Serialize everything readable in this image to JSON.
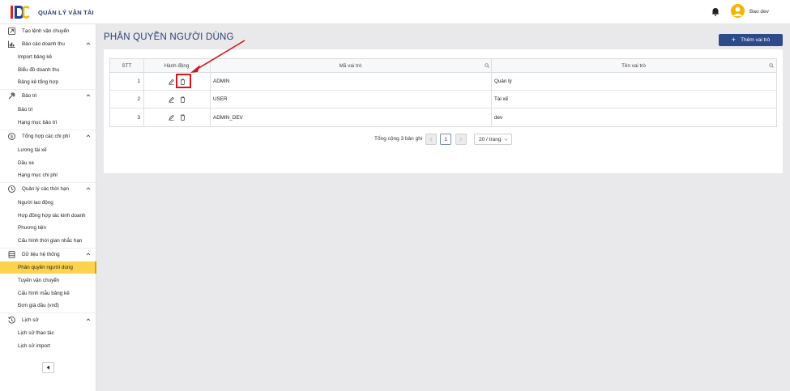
{
  "header": {
    "logo_text": "IDC",
    "app_title": "QUẢN LÝ VẬN TẢI",
    "user_name": "Bao dev"
  },
  "sidebar": {
    "top_item": "Tạo lệnh vận chuyển",
    "groups": [
      {
        "label": "Báo cáo doanh thu",
        "icon": "chart-icon",
        "items": [
          "Import bảng kê",
          "Biểu đồ doanh thu",
          "Bảng kê tổng hợp"
        ]
      },
      {
        "label": "Bảo trì",
        "icon": "wrench-icon",
        "items": [
          "Bảo trì",
          "Hạng mục bảo trì"
        ]
      },
      {
        "label": "Tổng hợp các chi phí",
        "icon": "dollar-icon",
        "items": [
          "Lương tài xế",
          "Dầu xe",
          "Hạng mục chi phí"
        ]
      },
      {
        "label": "Quản lý các thời hạn",
        "icon": "clock-icon",
        "items": [
          "Người lao động",
          "Hợp đồng hợp tác kinh doanh",
          "Phương tiện",
          "Cấu hình thời gian nhắc hạn"
        ]
      },
      {
        "label": "Dữ liệu hệ thống",
        "icon": "database-icon",
        "items": [
          "Phân quyền người dùng",
          "Tuyến vận chuyển",
          "Cấu hình mẫu bảng kê",
          "Đơn giá dầu (vnđ)"
        ]
      },
      {
        "label": "Lịch sử",
        "icon": "history-icon",
        "items": [
          "Lịch sử thao tác",
          "Lịch sử import"
        ]
      }
    ],
    "active_item": "Phân quyền người dùng"
  },
  "main": {
    "page_title": "PHÂN QUYỀN NGƯỜI DÙNG",
    "add_button": "Thêm vai trò",
    "table": {
      "columns": [
        "STT",
        "Hành động",
        "Mã vai trò",
        "Tên vai trò"
      ],
      "rows": [
        {
          "stt": "1",
          "code": "ADMIN",
          "name": "Quản lý"
        },
        {
          "stt": "2",
          "code": "USER",
          "name": "Tài xế"
        },
        {
          "stt": "3",
          "code": "ADMIN_DEV",
          "name": "dev"
        }
      ]
    },
    "pagination": {
      "total_text": "Tổng cộng 3 bản ghi",
      "current_page": "1",
      "page_size": "20 / trang"
    }
  },
  "colors": {
    "brand": "#2b3f73",
    "button": "#2d4a8a",
    "active_bg": "#fcd34d",
    "highlight": "#d6141c"
  }
}
